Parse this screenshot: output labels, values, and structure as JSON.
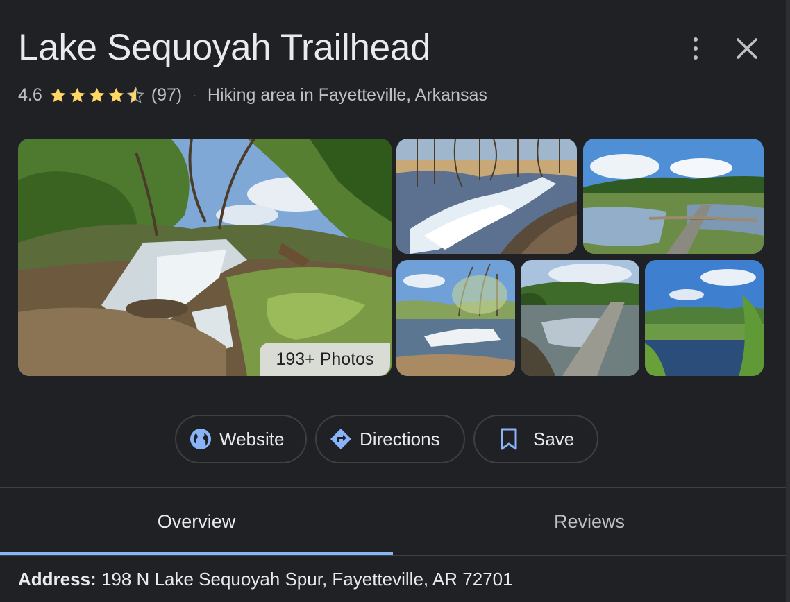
{
  "place": {
    "title": "Lake Sequoyah Trailhead",
    "rating": "4.6",
    "rating_value": 4.6,
    "review_count": "(97)",
    "separator": "·",
    "category": "Hiking area in Fayetteville, Arkansas"
  },
  "photos": {
    "badge": "193+ Photos",
    "items": [
      {
        "scene": "waterfall-cascade"
      },
      {
        "scene": "river-rapids-bare-trees"
      },
      {
        "scene": "wetland-boardwalk"
      },
      {
        "scene": "river-rapids-spring"
      },
      {
        "scene": "spillway-dam"
      },
      {
        "scene": "lake-hills"
      }
    ]
  },
  "actions": [
    {
      "label": "Website",
      "icon": "globe-icon"
    },
    {
      "label": "Directions",
      "icon": "directions-icon"
    },
    {
      "label": "Save",
      "icon": "bookmark-icon"
    }
  ],
  "tabs": [
    {
      "label": "Overview",
      "active": true
    },
    {
      "label": "Reviews",
      "active": false
    }
  ],
  "address": {
    "label": "Address:",
    "value": "198 N Lake Sequoyah Spur, Fayetteville, AR 72701"
  },
  "colors": {
    "background": "#202124",
    "accent": "#8ab4f8",
    "star": "#fdd663",
    "text": "#e8eaed",
    "secondary_text": "#bdc1c6"
  }
}
